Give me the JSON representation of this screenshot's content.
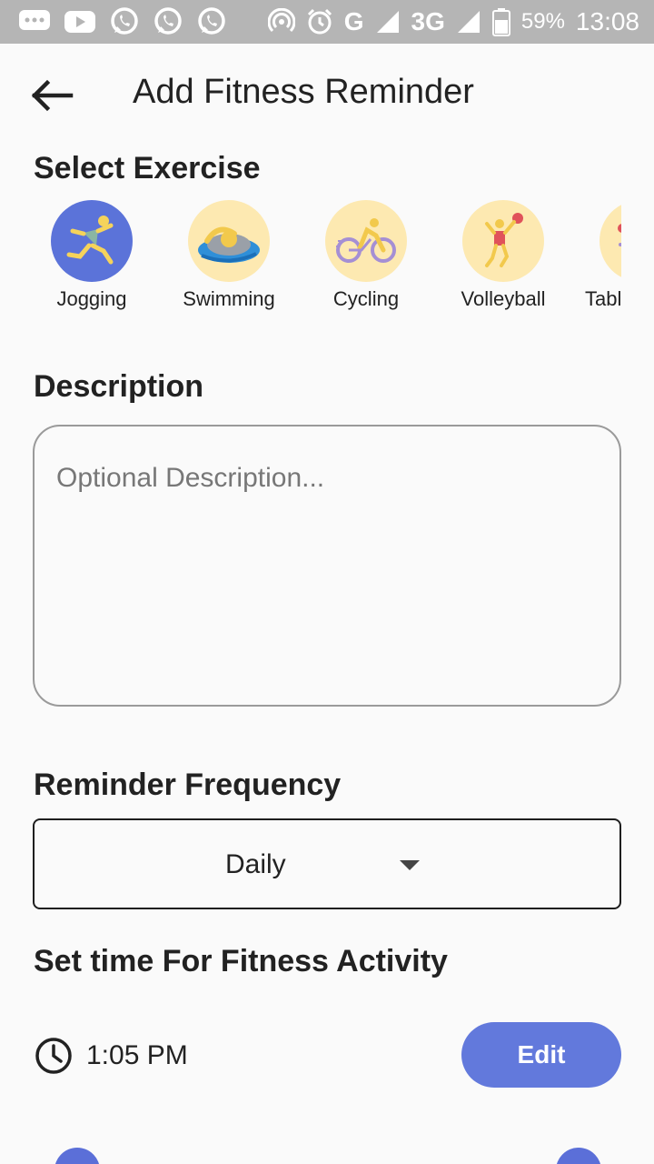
{
  "status_bar": {
    "network": "G",
    "network2": "3G",
    "battery": "59%",
    "time": "13:08",
    "icons": [
      "message-icon",
      "youtube-icon",
      "whatsapp-icon",
      "whatsapp-icon",
      "whatsapp-icon",
      "hotspot-icon",
      "alarm-icon",
      "signal-icon",
      "battery-icon"
    ]
  },
  "app_bar": {
    "back_icon": "arrow-back-icon",
    "title": "Add Fitness Reminder"
  },
  "exercise_section": {
    "title": "Select Exercise",
    "items": [
      {
        "label": "Jogging",
        "icon": "jogging-icon",
        "selected": true
      },
      {
        "label": "Swimming",
        "icon": "swimming-icon",
        "selected": false
      },
      {
        "label": "Cycling",
        "icon": "cycling-icon",
        "selected": false
      },
      {
        "label": "Volleyball",
        "icon": "volleyball-icon",
        "selected": false
      },
      {
        "label": "Table Tennis",
        "icon": "table-tennis-icon",
        "selected": false
      }
    ]
  },
  "description": {
    "title": "Description",
    "placeholder": "Optional Description...",
    "value": ""
  },
  "frequency": {
    "title": "Reminder Frequency",
    "selected": "Daily",
    "icon": "dropdown-arrow-icon"
  },
  "time_section": {
    "title": "Set time For Fitness Activity",
    "time": "1:05 PM",
    "clock_icon": "clock-icon",
    "edit_label": "Edit"
  },
  "colors": {
    "accent": "#6279dc",
    "selected_circle": "#5b73d9",
    "icon_circle": "#fde9b1",
    "status_bar": "#b5b5b5"
  }
}
